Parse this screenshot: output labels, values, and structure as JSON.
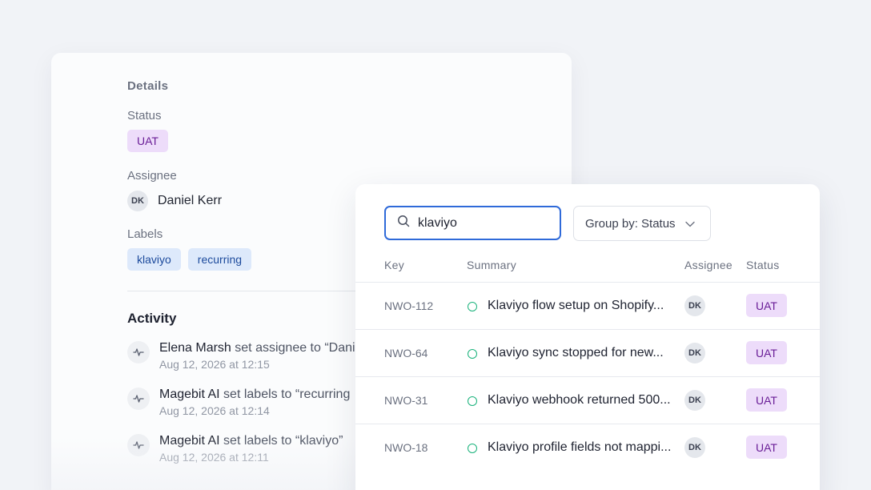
{
  "details": {
    "section_title": "Details",
    "status_label": "Status",
    "status_value": "UAT",
    "assignee_label": "Assignee",
    "assignee_initials": "DK",
    "assignee_name": "Daniel Kerr",
    "labels_label": "Labels",
    "labels": [
      "klaviyo",
      "recurring"
    ],
    "activity_title": "Activity",
    "activity": [
      {
        "actor": "Elena Marsh",
        "action": " set assignee to “Dani",
        "time": "Aug 12, 2026 at 12:15"
      },
      {
        "actor": "Magebit AI",
        "action": " set labels to “recurring",
        "time": "Aug 12, 2026 at 12:14"
      },
      {
        "actor": "Magebit AI",
        "action": " set labels to “klaviyo”",
        "time": "Aug 12, 2026 at 12:11"
      }
    ]
  },
  "search": {
    "value": "klaviyo",
    "group_by": "Group by: Status"
  },
  "table": {
    "columns": {
      "key": "Key",
      "summary": "Summary",
      "assignee": "Assignee",
      "status": "Status"
    },
    "rows": [
      {
        "key": "NWO-112",
        "summary": "Klaviyo flow setup on Shopify...",
        "assignee": "DK",
        "status": "UAT"
      },
      {
        "key": "NWO-64",
        "summary": "Klaviyo sync stopped for new...",
        "assignee": "DK",
        "status": "UAT"
      },
      {
        "key": "NWO-31",
        "summary": "Klaviyo webhook returned 500...",
        "assignee": "DK",
        "status": "UAT"
      },
      {
        "key": "NWO-18",
        "summary": "Klaviyo profile fields not mappi...",
        "assignee": "DK",
        "status": "UAT"
      }
    ]
  },
  "colors": {
    "accent": "#2f6ad9",
    "status_uat_bg": "#eddcfa",
    "status_uat_text": "#6a1e97",
    "label_bg": "#dde9fb",
    "label_text": "#1c4a9c",
    "status_dot": "#19b27b"
  },
  "icons": {
    "search": "search-icon",
    "chevron": "chevron-down-icon",
    "activity": "activity-icon",
    "status": "status-circle-icon"
  }
}
